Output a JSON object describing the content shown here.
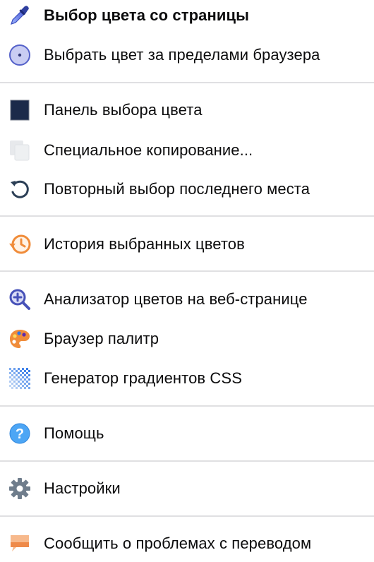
{
  "menu": {
    "items": [
      {
        "label": "Выбор цвета со страницы",
        "icon": "eyedropper-icon"
      },
      {
        "label": "Выбрать цвет за пределами браузера",
        "icon": "screen-target-icon"
      },
      {
        "label": "Панель выбора цвета",
        "icon": "color-square-icon"
      },
      {
        "label": "Специальное копирование...",
        "icon": "copy-icon"
      },
      {
        "label": "Повторный выбор последнего места",
        "icon": "reload-icon"
      },
      {
        "label": "История выбранных цветов",
        "icon": "history-clock-icon"
      },
      {
        "label": "Анализатор цветов на веб-странице",
        "icon": "magnifier-plus-icon"
      },
      {
        "label": "Браузер палитр",
        "icon": "palette-icon"
      },
      {
        "label": "Генератор градиентов CSS",
        "icon": "gradient-checker-icon"
      },
      {
        "label": "Помощь",
        "icon": "help-icon"
      },
      {
        "label": "Настройки",
        "icon": "gear-icon"
      },
      {
        "label": "Сообщить о проблемах с переводом",
        "icon": "speech-bubble-icon"
      }
    ]
  },
  "colors": {
    "text": "#0c0c0d",
    "separator": "#e0e0e2",
    "accent_blue": "#2f77e8",
    "accent_orange": "#f08c3a",
    "swatch_dark": "#1b2a4a"
  }
}
